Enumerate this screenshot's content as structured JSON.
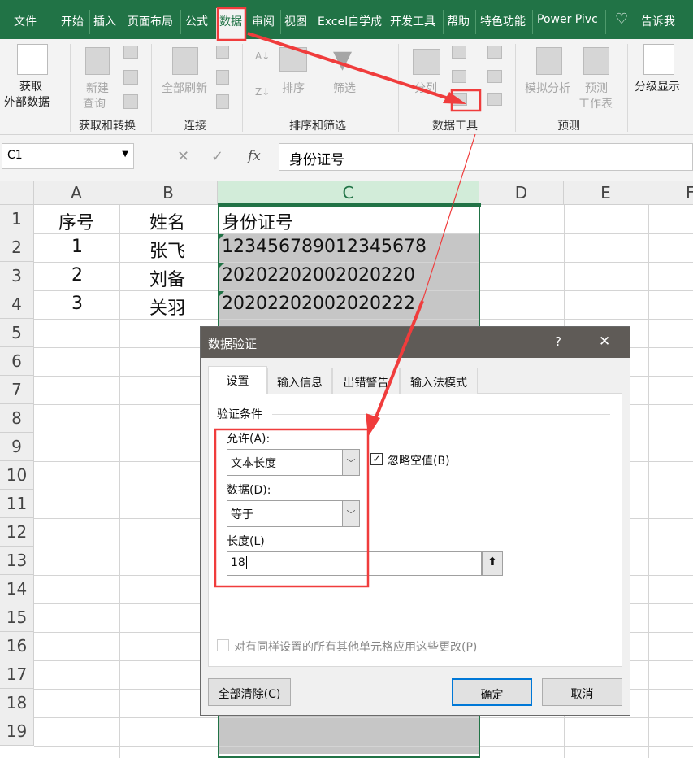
{
  "ribbon_tabs": [
    "文件",
    "开始",
    "插入",
    "页面布局",
    "公式",
    "数据",
    "审阅",
    "视图",
    "Excel自学成",
    "开发工具",
    "帮助",
    "特色功能",
    "Power Pivc",
    "告诉我"
  ],
  "active_tab": "数据",
  "ribbon": {
    "get_external": [
      "获取",
      "外部数据"
    ],
    "new_query": [
      "新建",
      "查询"
    ],
    "refresh_all": "全部刷新",
    "sort": "排序",
    "filter": "筛选",
    "text_to_columns": "分列",
    "what_if": "模拟分析",
    "forecast": [
      "预测",
      "工作表"
    ],
    "outline": "分级显示",
    "groups": [
      "获取和转换",
      "连接",
      "排序和筛选",
      "数据工具",
      "预测"
    ]
  },
  "formula_bar": {
    "name_box": "C1",
    "cancel": "✕",
    "enter": "✓",
    "fx": "fx",
    "value": "身份证号"
  },
  "columns": [
    "A",
    "B",
    "C",
    "D",
    "E",
    "F"
  ],
  "rows": [
    "1",
    "2",
    "3",
    "4",
    "5",
    "6",
    "7",
    "8",
    "9",
    "10",
    "11",
    "12",
    "13",
    "14",
    "15",
    "16",
    "17",
    "18",
    "19"
  ],
  "cells": [
    [
      "序号",
      "姓名",
      "身份证号"
    ],
    [
      "1",
      "张飞",
      "123456789012345678"
    ],
    [
      "2",
      "刘备",
      "20202202002020220"
    ],
    [
      "3",
      "关羽",
      "20202202002020222"
    ]
  ],
  "dialog": {
    "title": "数据验证",
    "help": "?",
    "close": "✕",
    "tabs": [
      "设置",
      "输入信息",
      "出错警告",
      "输入法模式"
    ],
    "section": "验证条件",
    "allow_label": "允许(A):",
    "allow_value": "文本长度",
    "ignore_blank": "忽略空值(B)",
    "ignore_blank_checked": true,
    "data_label": "数据(D):",
    "data_value": "等于",
    "length_label": "长度(L)",
    "length_value": "18",
    "apply_all": "对有同样设置的所有其他单元格应用这些更改(P)",
    "apply_all_checked": false,
    "clear_all": "全部清除(C)",
    "ok": "确定",
    "cancel": "取消"
  },
  "colors": {
    "excel_green": "#217346",
    "annotation_red": "#f03c3c",
    "dialog_title": "#5f5b57",
    "selection_gray": "#c6c6c6"
  }
}
